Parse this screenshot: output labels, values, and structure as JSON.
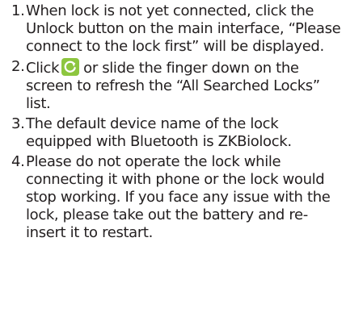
{
  "instructions": {
    "items": [
      {
        "number": "1.",
        "text": "When lock is not yet connected, click the Unlock button on the main interface, “Please connect to the lock first” will be displayed."
      },
      {
        "number": "2.",
        "text_before_icon": "Click",
        "icon": "refresh-icon",
        "text_after_icon": "or slide the finger down on the screen to refresh the “All Searched Locks” list."
      },
      {
        "number": "3.",
        "text": "The default device name of the lock equipped with Bluetooth is ZKBiolock."
      },
      {
        "number": "4.",
        "text": "Please do not operate the lock while connecting it with phone or the lock would stop working. If you face any issue with the lock, please take out the battery and re-insert it to restart."
      }
    ]
  },
  "colors": {
    "text": "#231f20",
    "icon_green": "#8dc63f"
  }
}
